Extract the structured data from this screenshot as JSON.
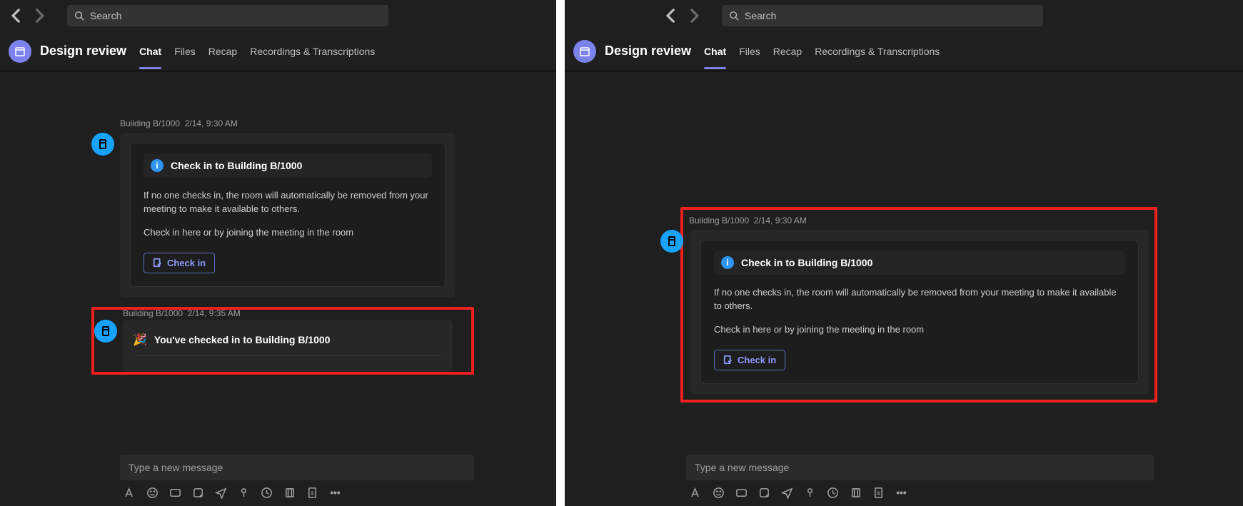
{
  "search": {
    "placeholder": "Search"
  },
  "header": {
    "title": "Design review",
    "tabs": [
      "Chat",
      "Files",
      "Recap",
      "Recordings & Transcriptions"
    ]
  },
  "message1": {
    "sender": "Building B/1000",
    "timestamp": "2/14, 9:30 AM",
    "card_title": "Check in to Building B/1000",
    "body1": "If no one checks in, the room will automatically be removed from your meeting to make it available to others.",
    "body2": "Check in here or by joining the meeting in the room",
    "button": "Check in"
  },
  "message2": {
    "sender": "Building B/1000",
    "timestamp": "2/14, 9:35 AM",
    "text": "You've checked in to Building B/1000"
  },
  "compose": {
    "placeholder": "Type a new message"
  }
}
